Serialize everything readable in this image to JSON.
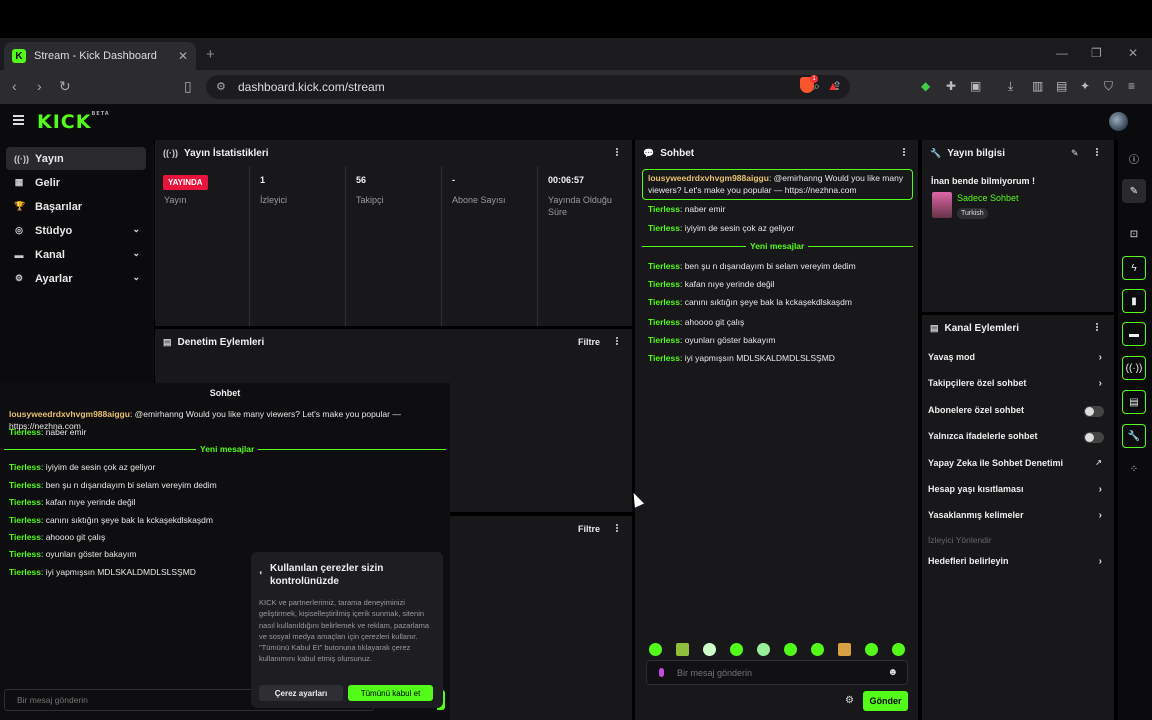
{
  "browser": {
    "tab_title": "Stream - Kick Dashboard",
    "tab_favicon": "K",
    "url": "dashboard.kick.com/stream",
    "brave_badge": "1"
  },
  "nav": {
    "items": [
      {
        "label": "Yayın",
        "icon": "broadcast-icon"
      },
      {
        "label": "Gelir",
        "icon": "revenue-icon"
      },
      {
        "label": "Başarılar",
        "icon": "trophy-icon"
      },
      {
        "label": "Stüdyo",
        "icon": "studio-icon"
      },
      {
        "label": "Kanal",
        "icon": "channel-icon"
      },
      {
        "label": "Ayarlar",
        "icon": "gear-icon"
      }
    ]
  },
  "stats": {
    "title": "Yayın İstatistikleri",
    "live_badge": "YAYINDA",
    "live_label": "Yayın",
    "viewers_value": "1",
    "viewers_label": "İzleyici",
    "followers_value": "56",
    "followers_label": "Takipçi",
    "subs_value": "-",
    "subs_label": "Abone Sayısı",
    "uptime_value": "00:06:57",
    "uptime_label": "Yayında Olduğu Süre"
  },
  "moderation": {
    "title": "Denetim Eylemleri",
    "filter": "Filtre",
    "filter2": "Filtre"
  },
  "chat": {
    "title": "Sohbet",
    "pinned": {
      "user": "lousyweedrdxvhvgm988aiggu",
      "text": ": @emirhanng Would you like many viewers? Let's make you popular — https://nezhna.com"
    },
    "new_messages": "Yeni mesajlar",
    "messages_before": [
      {
        "user": "Tierless",
        "text": ": naber emir"
      },
      {
        "user": "Tierless",
        "text": ": iyiyim de sesin çok az geliyor"
      }
    ],
    "messages_after": [
      {
        "user": "Tierless",
        "text": ": ben şu n dışarıdayım bi selam vereyim dedim"
      },
      {
        "user": "Tierless",
        "text": ": kafan nıye yerinde değil"
      },
      {
        "user": "Tierless",
        "text": ": canını sıktığın şeye bak la kckaşekdlskaşdm"
      },
      {
        "user": "Tierless",
        "text": ": ahoooo git çalış"
      },
      {
        "user": "Tierless",
        "text": ": oyunları göster bakayım"
      },
      {
        "user": "Tierless",
        "text": ": iyi yapmışsın MDLSKALDMDLSLSŞMD"
      }
    ],
    "input_placeholder": "Bir mesaj gönderin",
    "send": "Gönder"
  },
  "popchat": {
    "title": "Sohbet",
    "first": {
      "user": "lousyweedrdxvhvgm988aiggu",
      "text": ": @emirhanng Would you like many viewers? Let's make you popular — https://nezhna.com"
    },
    "second": {
      "user": "Tierless",
      "text": ": naber emir"
    },
    "new_messages": "Yeni mesajlar",
    "messages": [
      {
        "user": "Tierless",
        "text": ": iyiyim de sesin çok az geliyor"
      },
      {
        "user": "Tierless",
        "text": ": ben şu n dışarıdayım bi selam vereyim dedim"
      },
      {
        "user": "Tierless",
        "text": ": kafan nıye yerinde değil"
      },
      {
        "user": "Tierless",
        "text": ": canını sıktığın şeye bak la kckaşekdlskaşdm"
      },
      {
        "user": "Tierless",
        "text": ": ahoooo git çalış"
      },
      {
        "user": "Tierless",
        "text": ": oyunları göster bakayım"
      },
      {
        "user": "Tierless",
        "text": ": iyi yapmışsın MDLSKALDMDLSLSŞMD"
      }
    ],
    "input_placeholder": "Bir mesaj gönderin"
  },
  "cookie": {
    "title": "Kullanılan çerezler sizin kontrolünüzde",
    "body": "KICK ve partnerlerimiz, tarama deneyiminizi geliştirmek, kişiselleştirilmiş içerik sunmak, sitenin nasıl kullanıldığını belirlemek ve reklam, pazarlama ve sosyal medya amaçları için çerezleri kullanır. \"Tümünü Kabul Et\" butonuna tıklayarak çerez kullanımını kabul etmiş olursunuz.",
    "settings_btn": "Çerez ayarları",
    "accept_btn": "Tümünü kabul et"
  },
  "stream_info": {
    "title": "Yayın bilgisi",
    "stream_title": "İnan bende bilmiyorum !",
    "category": "Sadece Sohbet",
    "language": "Turkish"
  },
  "channel_actions": {
    "title": "Kanal Eylemleri",
    "slow_mode": "Yavaş mod",
    "followers_only": "Takipçilere özel sohbet",
    "subs_only": "Abonelere özel sohbet",
    "emotes_only": "Yalnızca ifadelerle sohbet",
    "ai_moderation": "Yapay Zeka ile Sohbet Denetimi",
    "account_age": "Hesap yaşı kısıtlaması",
    "banned_words": "Yasaklanmış kelimeler",
    "viewer_section": "İzleyici Yönlendir",
    "goals": "Hedefleri belirleyin"
  },
  "colors": {
    "accent": "#53fc18",
    "live": "#e8143c",
    "panel": "#18181b",
    "username_pinned": "#e6c070"
  }
}
